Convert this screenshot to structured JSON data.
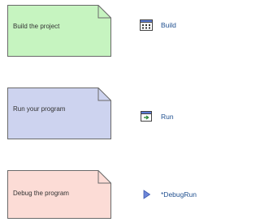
{
  "notes": [
    {
      "text": "Build the project",
      "fill": "#c6f4c0",
      "stroke": "#6a6a6a"
    },
    {
      "text": "Run your program",
      "fill": "#cdd3ef",
      "stroke": "#6a6a6a"
    },
    {
      "text": "Debug the program",
      "fill": "#fcdcd6",
      "stroke": "#6a6a6a"
    }
  ],
  "actions": [
    {
      "label": "Build",
      "icon": "build-script-icon"
    },
    {
      "label": "Run",
      "icon": "run-window-icon"
    },
    {
      "label": "*DebugRun",
      "icon": "play-triangle-icon"
    }
  ],
  "colors": {
    "link": "#1f4f8f",
    "icon_blue": "#5b7bd5",
    "icon_green": "#2d8a3a"
  }
}
